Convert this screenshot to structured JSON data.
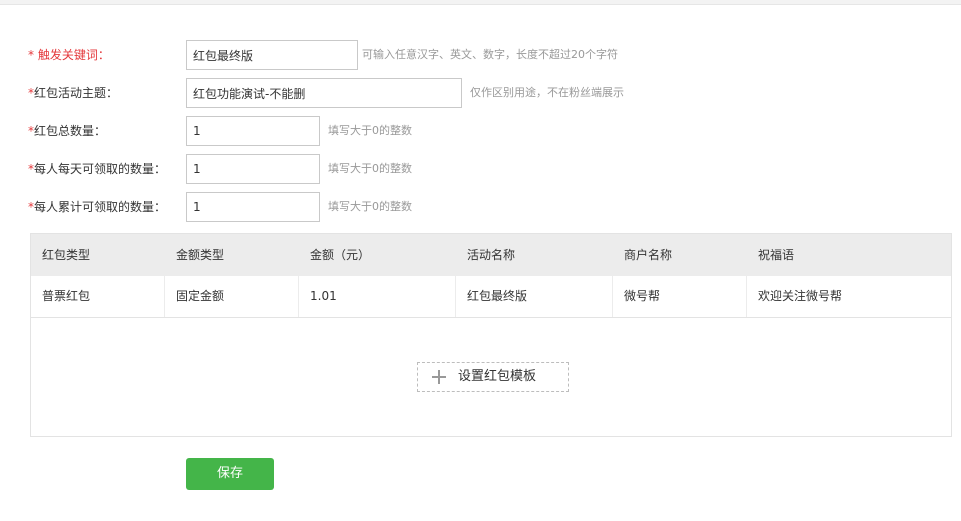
{
  "form": {
    "keyword": {
      "star": "* ",
      "label": "触发关键词：",
      "value": "红包最终版",
      "hint": "可输入任意汉字、英文、数字，长度不超过20个字符"
    },
    "theme": {
      "star": "*",
      "label": "红包活动主题：",
      "value": "红包功能演试-不能删",
      "hint": "仅作区别用途，不在粉丝端展示"
    },
    "total": {
      "star": "*",
      "label": "红包总数量：",
      "value": "1",
      "hint": "填写大于0的整数"
    },
    "daily": {
      "star": "*",
      "label": "每人每天可领取的数量：",
      "value": "1",
      "hint": "填写大于0的整数"
    },
    "cumulative": {
      "star": "*",
      "label": "每人累计可领取的数量：",
      "value": "1",
      "hint": "填写大于0的整数"
    }
  },
  "table": {
    "headers": [
      "红包类型",
      "金额类型",
      "金额（元）",
      "活动名称",
      "商户名称",
      "祝福语"
    ],
    "rows": [
      [
        "普票红包",
        "固定金额",
        "1.01",
        "红包最终版",
        "微号帮",
        "欢迎关注微号帮"
      ]
    ],
    "add_template_label": "设置红包模板"
  },
  "actions": {
    "save_label": "保存"
  },
  "colors": {
    "required": "#e4393c",
    "primary_button": "#44b549",
    "hint_text": "#999999"
  }
}
